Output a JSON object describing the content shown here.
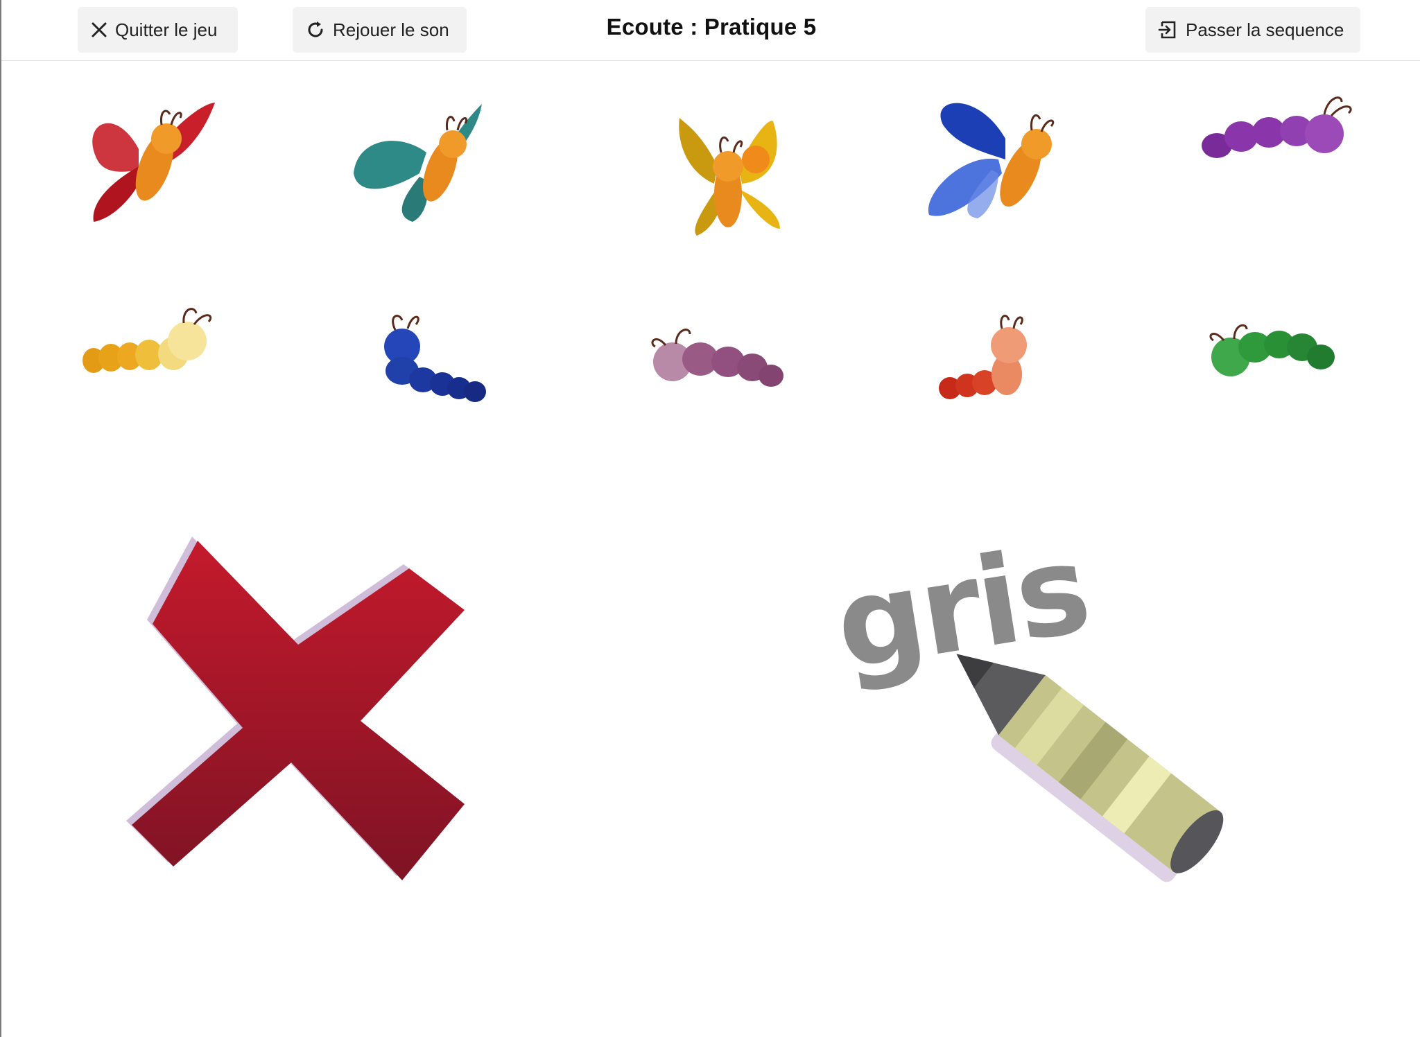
{
  "header": {
    "quit_label": "Quitter le jeu",
    "replay_label": "Rejouer le son",
    "title": "Ecoute : Pratique 5",
    "skip_label": "Passer la sequence"
  },
  "icons": {
    "quit": "close-icon",
    "replay": "reload-icon",
    "skip": "exit-sequence-icon"
  },
  "board": {
    "row1": [
      {
        "kind": "butterfly",
        "color": "red"
      },
      {
        "kind": "butterfly",
        "color": "teal"
      },
      {
        "kind": "butterfly",
        "color": "yellow"
      },
      {
        "kind": "butterfly",
        "color": "blue"
      },
      {
        "kind": "caterpillar",
        "color": "purple"
      }
    ],
    "row2": [
      {
        "kind": "caterpillar",
        "color": "orange-yellow"
      },
      {
        "kind": "caterpillar",
        "color": "blue"
      },
      {
        "kind": "caterpillar",
        "color": "mauve"
      },
      {
        "kind": "caterpillar",
        "color": "red-salmon"
      },
      {
        "kind": "caterpillar",
        "color": "green"
      }
    ]
  },
  "cards": {
    "no_card": {
      "symbol": "cross",
      "color": "#b3162b"
    },
    "color_card": {
      "word": "gris",
      "word_color": "#8a8a8a",
      "crayon_color": "#c9c98a"
    }
  }
}
